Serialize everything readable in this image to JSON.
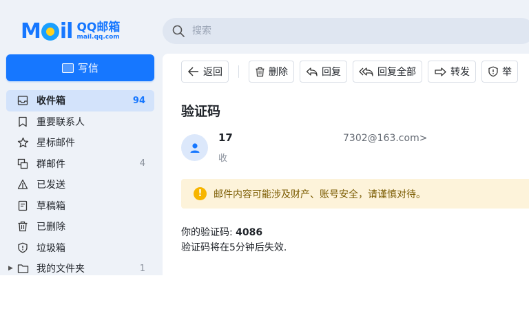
{
  "logo": {
    "mark": "MOil",
    "qq": "QQ邮箱",
    "url": "mail.qq.com"
  },
  "search": {
    "placeholder": "搜索"
  },
  "compose": {
    "label": "写信"
  },
  "sidebar": {
    "items": [
      {
        "label": "收件箱",
        "count": "94",
        "icon": "inbox-icon"
      },
      {
        "label": "重要联系人",
        "count": "",
        "icon": "bookmark-icon"
      },
      {
        "label": "星标邮件",
        "count": "",
        "icon": "star-icon"
      },
      {
        "label": "群邮件",
        "count": "4",
        "icon": "group-icon"
      },
      {
        "label": "已发送",
        "count": "",
        "icon": "send-icon"
      },
      {
        "label": "草稿箱",
        "count": "",
        "icon": "draft-icon"
      },
      {
        "label": "已删除",
        "count": "",
        "icon": "trash-icon"
      },
      {
        "label": "垃圾箱",
        "count": "",
        "icon": "shield-icon"
      },
      {
        "label": "我的文件夹",
        "count": "1",
        "icon": "folder-icon"
      }
    ]
  },
  "toolbar": {
    "back": "返回",
    "delete": "删除",
    "reply": "回复",
    "reply_all": "回复全部",
    "forward": "转发",
    "spam": "举"
  },
  "email": {
    "subject": "验证码",
    "sender_name": "17",
    "sender_email": "7302@163.com>",
    "recipient_label": "收",
    "warning": "邮件内容可能涉及财产、账号安全，请谨慎对待。",
    "body_prefix": "你的验证码: ",
    "code": "4086",
    "body_line2": "验证码将在5分钟后失效."
  },
  "colors": {
    "accent": "#1677ff",
    "warning_bg": "#fdf3da",
    "warning_icon": "#f7b500",
    "sidebar_bg": "#eef2f8"
  }
}
